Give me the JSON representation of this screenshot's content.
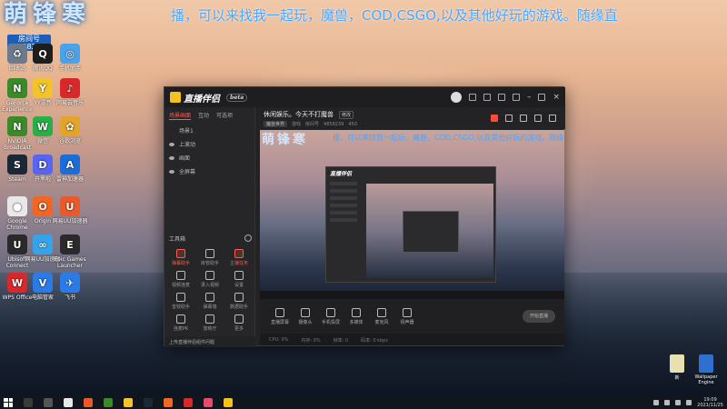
{
  "banner": {
    "logo": "萌锋寒",
    "marquee": "播，可以来找我一起玩，魔兽，COD,CSGO,以及其他好玩的游戏。随缘直",
    "id_line1": "房间号",
    "id_line2": "4858239"
  },
  "desktop_icons": [
    {
      "name": "recycle-bin-icon",
      "label": "回收站",
      "color": "#6b7a8c",
      "glyph": "♻"
    },
    {
      "name": "qq-icon",
      "label": "腾讯QQ",
      "color": "#1e1e1e",
      "glyph": "Q"
    },
    {
      "name": "mobile-manager-icon",
      "label": "手机助手",
      "color": "#4aa2e8",
      "glyph": "◎"
    },
    {
      "name": "geforce-experience-icon",
      "label": "GeForce Experience",
      "color": "#3a8a2a",
      "glyph": "N"
    },
    {
      "name": "yy-voice-icon",
      "label": "YY语音",
      "color": "#f2c32a",
      "glyph": "Y"
    },
    {
      "name": "netease-music-icon",
      "label": "网易云音乐",
      "color": "#d8292a",
      "glyph": "♪"
    },
    {
      "name": "nvidia-broadcast-icon",
      "label": "NVIDIA Broadcast",
      "color": "#3a8a2a",
      "glyph": "N"
    },
    {
      "name": "wechat-icon",
      "label": "微信",
      "color": "#2aae46",
      "glyph": "W"
    },
    {
      "name": "pinwheel-app-icon",
      "label": "谷歌浏览",
      "color": "#e3a42a",
      "glyph": "✿"
    },
    {
      "name": "steam-icon",
      "label": "Steam",
      "color": "#1b2838",
      "glyph": "S"
    },
    {
      "name": "discord-icon",
      "label": "开黑啦",
      "color": "#5865f2",
      "glyph": "D"
    },
    {
      "name": "booster-icon",
      "label": "雷神加速器",
      "color": "#1c6dd8",
      "glyph": "A"
    },
    {
      "name": "chrome-icon",
      "label": "Google Chrome",
      "color": "#e8e8e8",
      "glyph": "●"
    },
    {
      "name": "origin-icon",
      "label": "Origin",
      "color": "#f26522",
      "glyph": "O"
    },
    {
      "name": "net-booster-icon",
      "label": "网易UU加速器",
      "color": "#e85a2a",
      "glyph": "U"
    },
    {
      "name": "ubisoft-connect-icon",
      "label": "Ubisoft Connect",
      "color": "#2a2a2a",
      "glyph": "U"
    },
    {
      "name": "uu-accelerator-icon",
      "label": "网易UU加速器",
      "color": "#36a3e8",
      "glyph": "∞"
    },
    {
      "name": "epic-games-icon",
      "label": "Epic Games Launcher",
      "color": "#2a2a2a",
      "glyph": "E"
    },
    {
      "name": "wps-office-icon",
      "label": "WPS Office",
      "color": "#d8292a",
      "glyph": "W"
    },
    {
      "name": "pc-manager-icon",
      "label": "电脑管家",
      "color": "#2a7be8",
      "glyph": "V"
    },
    {
      "name": "feishu-icon",
      "label": "飞书",
      "color": "#2a7be8",
      "glyph": "✈"
    }
  ],
  "right_icons": [
    {
      "name": "folder-icon",
      "label": "新"
    },
    {
      "name": "installer-icon",
      "label": "Wallpaper Engine"
    }
  ],
  "app": {
    "logo": "直播伴侣",
    "version": "beta",
    "side_tabs": [
      "场景画面",
      "互动",
      "可选项"
    ],
    "scenes": [
      "场景1",
      "上滚动",
      "画面",
      "全屏幕"
    ],
    "tools_title": "工具箱",
    "tools": [
      "弹幕助手",
      "房管助手",
      "主播任务",
      "视频连麦",
      "录入视频",
      "设置",
      "音效助手",
      "弹幕墙",
      "数据助手",
      "连麦PK",
      "放映厅",
      "更多"
    ],
    "footer": "上传直播伴侣组件问题",
    "stream_title": "休闲娱乐。今天不打魔兽",
    "edit_label": "修改",
    "stream_tag": "魔兽世界",
    "stream_category": "游戏",
    "room_label": "房间号",
    "room_id": "4858239",
    "viewer_count": "450",
    "preview_marquee": "播，可以来找我一起玩，魔兽，COD,CSGO,以及其他好玩的游戏。随缘",
    "preview_logo": "萌锋寒",
    "nested_logo": "直播伴侣",
    "controls": [
      "直播屏幕",
      "摄像头",
      "手机投屏",
      "多媒体",
      "麦克风",
      "扬声器"
    ],
    "go_live": "开始直播",
    "status": [
      "CPU: 0%",
      "内存: 0%",
      "帧率: 0",
      "码率: 0 kbps"
    ]
  },
  "taskbar": {
    "time": "19:09",
    "date": "2021/11/25"
  }
}
